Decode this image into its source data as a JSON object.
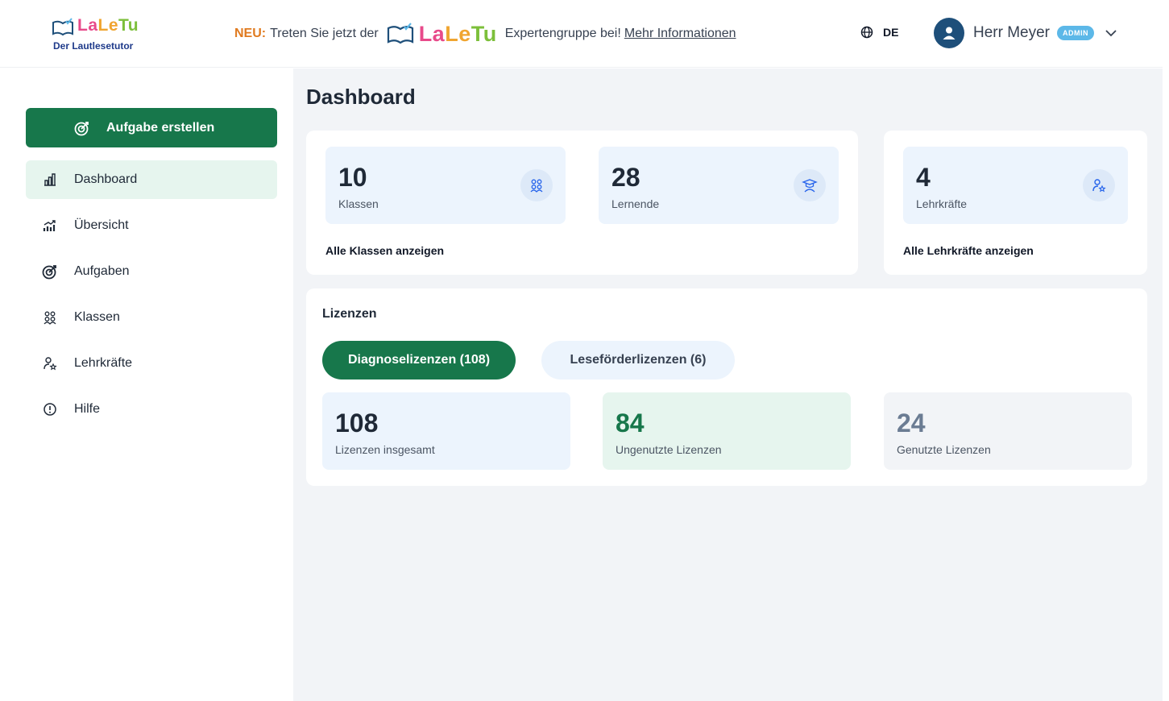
{
  "header": {
    "logo": {
      "letters": [
        "La",
        "Le",
        "Tu"
      ],
      "subtitle": "Der Lautlesetutor"
    },
    "banner": {
      "neu": "NEU:",
      "text_before": "Treten Sie jetzt der",
      "logo_letters": [
        "La",
        "Le",
        "Tu"
      ],
      "text_after": "Expertengruppe bei!",
      "link": "Mehr Informationen"
    },
    "language": {
      "icon": "globe-icon",
      "code": "DE"
    },
    "user": {
      "name": "Herr Meyer",
      "badge": "ADMIN",
      "icon": "user-avatar-icon"
    }
  },
  "sidebar": {
    "create_button": {
      "label": "Aufgabe erstellen",
      "icon": "target-plus-icon"
    },
    "items": [
      {
        "label": "Dashboard",
        "icon": "bar-chart-icon",
        "active": true
      },
      {
        "label": "Übersicht",
        "icon": "trend-chart-icon",
        "active": false
      },
      {
        "label": "Aufgaben",
        "icon": "target-icon",
        "active": false
      },
      {
        "label": "Klassen",
        "icon": "group-icon",
        "active": false
      },
      {
        "label": "Lehrkräfte",
        "icon": "teacher-icon",
        "active": false
      },
      {
        "label": "Hilfe",
        "icon": "help-icon",
        "active": false
      }
    ]
  },
  "main": {
    "title": "Dashboard",
    "stats": [
      {
        "value": "10",
        "label": "Klassen",
        "icon": "group-icon"
      },
      {
        "value": "28",
        "label": "Lernende",
        "icon": "student-cap-icon"
      },
      {
        "value": "4",
        "label": "Lehrkräfte",
        "icon": "teacher-icon"
      }
    ],
    "link_classes": "Alle Klassen anzeigen",
    "link_teachers": "Alle Lehrkräfte anzeigen",
    "licenses": {
      "title": "Lizenzen",
      "tabs": [
        {
          "label": "Diagnoselizenzen (108)",
          "active": true
        },
        {
          "label": "Leseförderlizenzen (6)",
          "active": false
        }
      ],
      "stats": [
        {
          "value": "108",
          "label": "Lizenzen insgesamt",
          "color": "#1f2937",
          "bg": "#ecf4fd"
        },
        {
          "value": "84",
          "label": "Ungenutzte Lizenzen",
          "color": "#17774b",
          "bg": "#e6f5ee"
        },
        {
          "value": "24",
          "label": "Genutzte Lizenzen",
          "color": "#6b7c93",
          "bg": "#f2f4f7"
        }
      ]
    }
  },
  "colors": {
    "primary": "#17774b",
    "accent_light": "#e6f5ee",
    "card_blue": "#ecf4fd",
    "badge": "#5cb8e8"
  }
}
